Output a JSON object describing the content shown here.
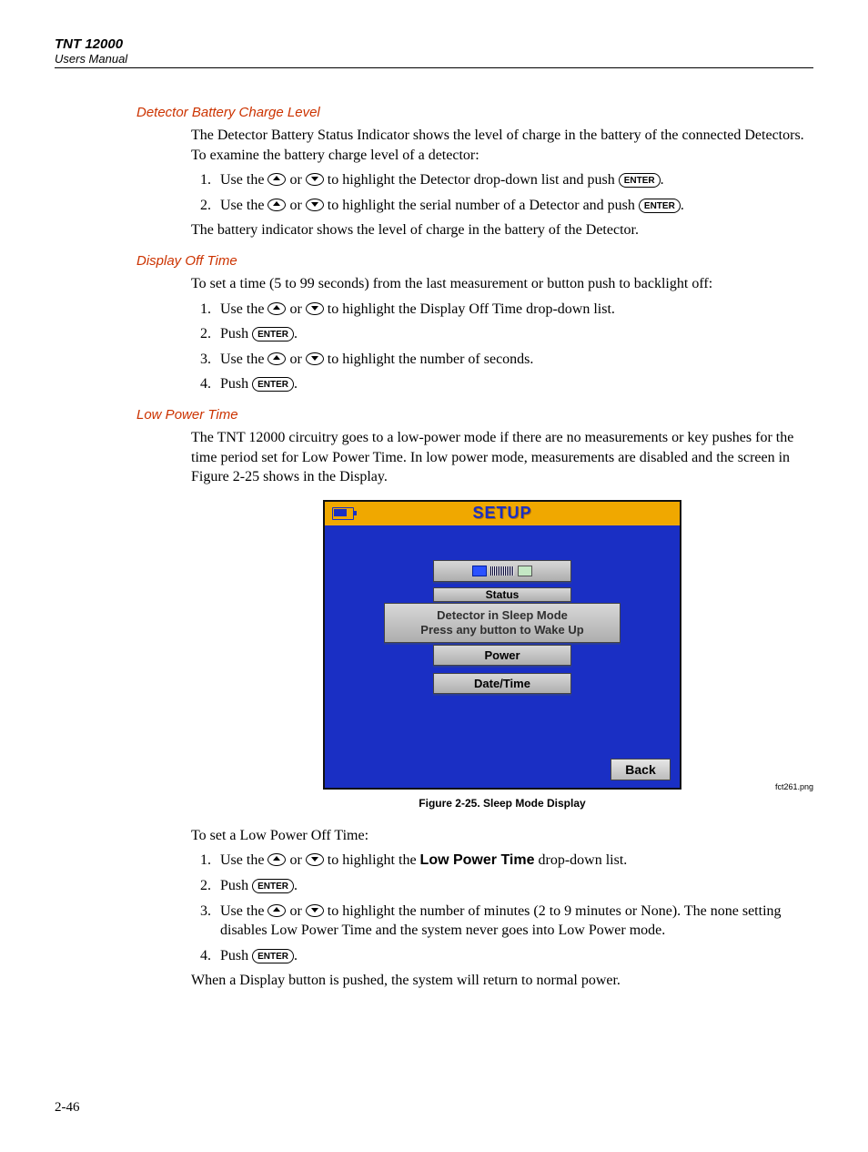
{
  "header": {
    "title": "TNT 12000",
    "subtitle": "Users Manual"
  },
  "keycap": {
    "enter": "ENTER"
  },
  "sections": {
    "battery": {
      "heading": "Detector Battery Charge Level",
      "intro": "The Detector Battery Status Indicator shows the level of charge in the battery of the connected Detectors. To examine the battery charge level of a detector:",
      "step1_a": "Use the ",
      "step1_b": " or ",
      "step1_c": " to highlight the Detector drop-down list and push ",
      "step1_d": ".",
      "step2_a": "Use the ",
      "step2_b": " or ",
      "step2_c": " to highlight the serial number of a Detector and push ",
      "step2_d": ".",
      "outro": "The battery indicator shows the level of charge in the battery of the Detector."
    },
    "display_off": {
      "heading": "Display Off Time",
      "intro": "To set a time (5 to 99 seconds) from the last measurement or button push to backlight off:",
      "step1_a": "Use the ",
      "step1_b": " or ",
      "step1_c": " to highlight the Display Off Time drop-down list.",
      "step2_a": "Push ",
      "step2_b": ".",
      "step3_a": "Use the ",
      "step3_b": " or ",
      "step3_c": " to highlight the number of seconds.",
      "step4_a": "Push ",
      "step4_b": "."
    },
    "low_power": {
      "heading": "Low Power Time",
      "intro": "The TNT 12000 circuitry goes to a low-power mode if there are no measurements or key pushes for the time period set for Low Power Time. In low power mode, measurements are disabled and the screen in Figure 2-25 shows in the Display.",
      "after_fig": "To set a Low Power Off Time:",
      "step1_a": "Use the ",
      "step1_b": " or ",
      "step1_c": " to highlight the ",
      "step1_bold": "Low Power Time",
      "step1_d": " drop-down list.",
      "step2_a": "Push ",
      "step2_b": ".",
      "step3_a": "Use the ",
      "step3_b": " or ",
      "step3_c": " to highlight the number of minutes (2 to 9 minutes or None). The none setting disables Low Power Time and the system never goes into Low Power mode.",
      "step4_a": "Push ",
      "step4_b": ".",
      "outro": "When a Display button is pushed, the system will return to normal power."
    }
  },
  "figure": {
    "title": "SETUP",
    "partial_label": "Status",
    "overlay_l1": "Detector in Sleep Mode",
    "overlay_l2": "Press any button to Wake Up",
    "btn_power": "Power",
    "btn_datetime": "Date/Time",
    "btn_back": "Back",
    "img_ref": "fct261.png",
    "caption": "Figure 2-25. Sleep Mode Display"
  },
  "page_number": "2-46"
}
